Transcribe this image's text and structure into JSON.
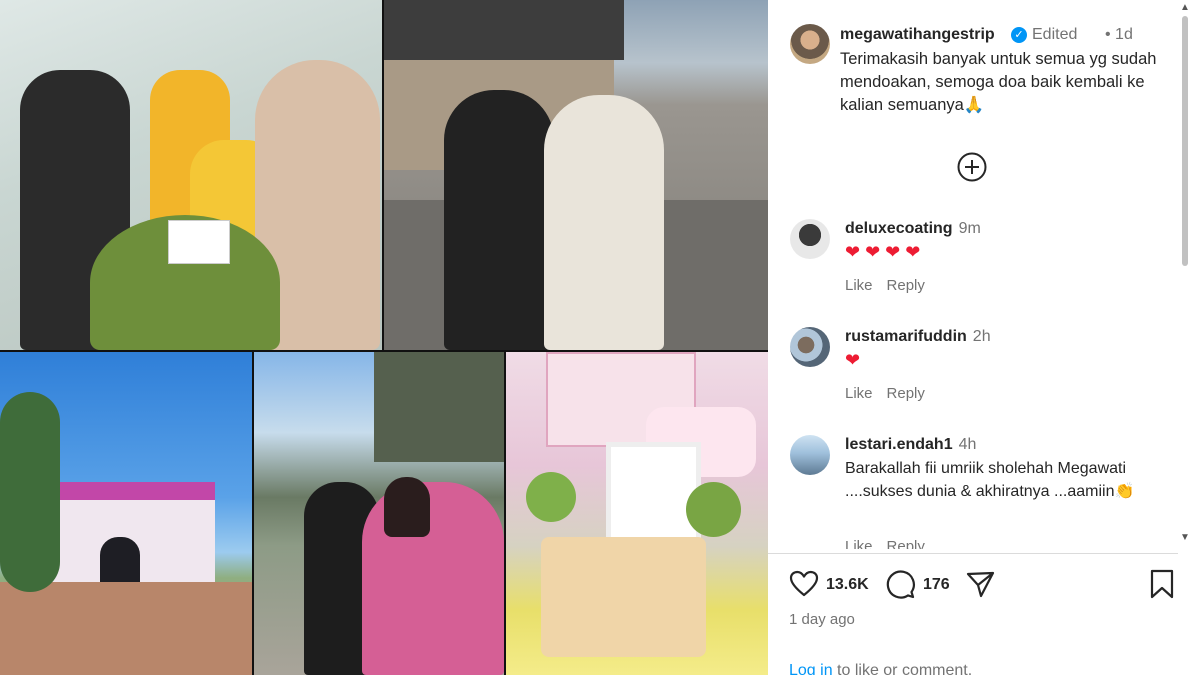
{
  "post": {
    "author": "megawatihangestrip",
    "edited_label": "Edited",
    "time_ago": "• 1d",
    "caption": "Terimakasih banyak untuk semua yg sudah mendoakan, semoga doa baik kembali ke kalian semuanya🙏"
  },
  "comments": [
    {
      "username": "deluxecoating",
      "time": "9m",
      "text": "",
      "hearts": "❤❤❤❤",
      "like_label": "Like",
      "reply_label": "Reply"
    },
    {
      "username": "rustamarifuddin",
      "time": "2h",
      "text": "",
      "hearts": "❤",
      "like_label": "Like",
      "reply_label": "Reply"
    },
    {
      "username": "lestari.endah1",
      "time": "4h",
      "text": "Barakallah fii umriik sholehah Megawati ....sukses dunia & akhiratnya ...aamiin👏",
      "hearts": "",
      "like_label": "Like",
      "reply_label": "Reply"
    }
  ],
  "actions": {
    "like_count": "13.6K",
    "comment_count": "176"
  },
  "post_age": "1 day ago",
  "login": {
    "link_text": "Log in",
    "rest_text": " to like or comment."
  },
  "colors": {
    "link_blue": "#0095f6",
    "heart_red": "#ed1c33",
    "muted_text": "#737373",
    "primary_text": "#262626"
  },
  "icons": [
    "verified-icon",
    "add-circle-icon",
    "heart-outline-icon",
    "comment-icon",
    "share-icon",
    "bookmark-icon",
    "scroll-up-icon",
    "scroll-down-icon"
  ]
}
